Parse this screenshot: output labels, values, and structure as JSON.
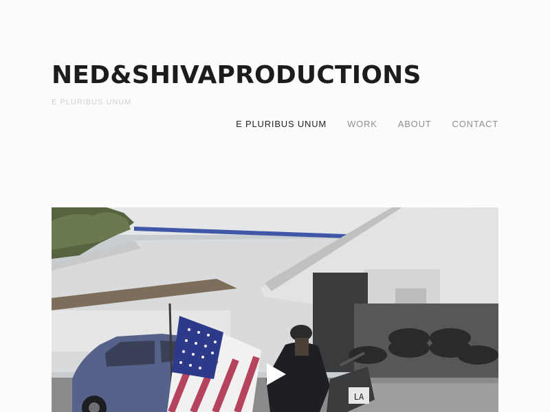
{
  "site": {
    "title": "NED&SHIVAPRODUCTIONS",
    "tagline": "E PLURIBUS UNUM"
  },
  "nav": {
    "items": [
      {
        "label": "E PLURIBUS UNUM",
        "active": true
      },
      {
        "label": "WORK",
        "active": false
      },
      {
        "label": "ABOUT",
        "active": false
      },
      {
        "label": "CONTACT",
        "active": false
      }
    ]
  },
  "video": {
    "play_icon": "play-icon"
  },
  "colors": {
    "title": "#1c1c1c",
    "nav_active": "#222222",
    "nav_inactive": "#8e8e8e",
    "tagline": "#cfcfcf",
    "background": "#fcfcfc"
  }
}
